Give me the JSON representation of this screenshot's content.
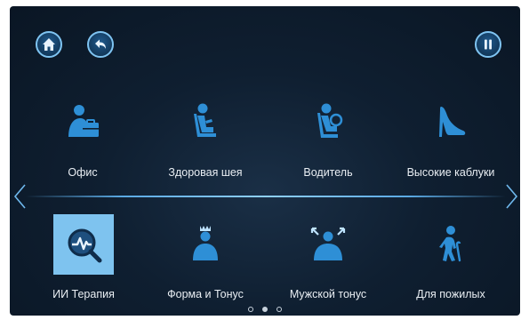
{
  "toolbar": {
    "home_icon": "home-icon",
    "back_icon": "back-icon",
    "pause_icon": "pause-icon"
  },
  "programs_row1": [
    {
      "label": "Офис",
      "icon": "office-worker-icon"
    },
    {
      "label": "Здоровая шея",
      "icon": "seated-person-icon"
    },
    {
      "label": "Водитель",
      "icon": "driver-icon"
    },
    {
      "label": "Высокие каблуки",
      "icon": "high-heel-icon"
    }
  ],
  "programs_row2": [
    {
      "label": "ИИ Терапия",
      "icon": "ai-therapy-icon",
      "selected": true
    },
    {
      "label": "Форма и Тонус",
      "icon": "shape-tone-icon"
    },
    {
      "label": "Мужской тонус",
      "icon": "male-tone-icon"
    },
    {
      "label": "Для пожилых",
      "icon": "elderly-icon"
    }
  ],
  "pagination": {
    "pages": 3,
    "current": 2
  },
  "colors": {
    "accent": "#7ec3ef",
    "icon": "#2e8fd6",
    "background": "#0f1f31"
  }
}
